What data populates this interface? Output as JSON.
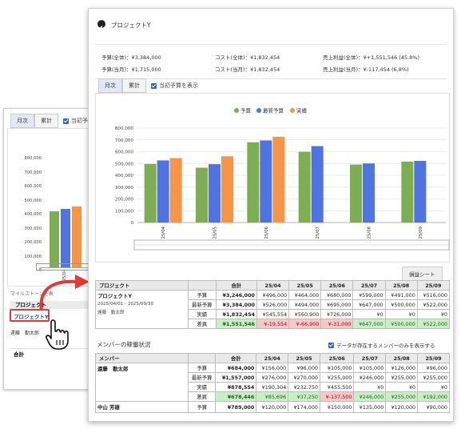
{
  "bg": {
    "tabs": [
      "月次",
      "累計"
    ],
    "checkbox_label": "当初予算を",
    "y_ticks": [
      "800,000",
      "700,000",
      "600,000",
      "500,000",
      "400,000",
      "300,000",
      "200,000",
      "100,000",
      "0"
    ],
    "x_label": "25/04",
    "milestone_label": "マイルストーンを表",
    "project_header": "プロジェクト",
    "project_name": "プロジェクトY",
    "member_name": "遠藤　勤太郎",
    "total_label": "合計"
  },
  "fg": {
    "title": "プロジェクトY",
    "summary": {
      "budget_total": "予算(全体)：¥3,384,000",
      "budget_month": "予算(当月)：¥1,715,000",
      "cost_total": "コスト(全体)：¥1,832,454",
      "cost_month": "コスト(当月)：¥1,832,454",
      "profit_total": "売上利益(全体)：¥+1,551,546 (45.8%)",
      "profit_month": "売上利益(当月)：¥-117,454 (6.8%)"
    },
    "tabs": [
      "月次",
      "累計"
    ],
    "checkbox_label": "当初予算を表示",
    "pl_button": "損益シート",
    "project_table": {
      "headers": [
        "プロジェクト",
        "",
        "合計",
        "25/04",
        "25/05",
        "25/06",
        "25/07",
        "25/08",
        "25/09"
      ],
      "name": "プロジェクトY",
      "period": "2025/04/01 - 2025/09/30",
      "member": "遠藤　勤太郎",
      "rows": [
        {
          "label": "予算",
          "values": [
            "¥3,246,000",
            "¥496,000",
            "¥464,000",
            "¥680,000",
            "¥599,000",
            "¥491,000",
            "¥516,000"
          ]
        },
        {
          "label": "最新予算",
          "values": [
            "¥3,384,000",
            "¥526,000",
            "¥494,000",
            "¥695,000",
            "¥647,000",
            "¥500,000",
            "¥522,000"
          ]
        },
        {
          "label": "実績",
          "values": [
            "¥1,832,454",
            "¥545,554",
            "¥560,900",
            "¥726,000",
            "¥0",
            "¥0",
            "¥0"
          ]
        },
        {
          "label": "差異",
          "values": [
            "¥1,551,546",
            "¥-19,554",
            "¥-66,900",
            "¥-31,000",
            "¥647,000",
            "¥500,000",
            "¥522,000"
          ]
        }
      ]
    },
    "member_section_title": "メンバーの稼働状況",
    "member_checkbox_label": "データが存在するメンバーのみを表示する",
    "member_table": {
      "headers": [
        "メンバー",
        "",
        "合計",
        "25/04",
        "25/05",
        "25/06",
        "25/07",
        "25/08",
        "25/09"
      ],
      "member1": "遠藤　勤太郎",
      "member1_rows": [
        {
          "label": "予算",
          "values": [
            "¥684,000",
            "¥156,000",
            "¥96,000",
            "¥105,000",
            "¥105,000",
            "¥126,000",
            "¥96,000"
          ]
        },
        {
          "label": "最新予算",
          "values": [
            "¥1,557,000",
            "¥276,000",
            "¥270,000",
            "¥255,000",
            "¥246,000",
            "¥255,000",
            "¥255,000"
          ]
        },
        {
          "label": "実績",
          "values": [
            "¥878,554",
            "¥190,304",
            "¥232,750",
            "¥455,500",
            "¥0",
            "¥0",
            "¥0"
          ]
        },
        {
          "label": "差異",
          "values": [
            "¥678,446",
            "¥85,696",
            "¥37,250",
            "¥-137,500",
            "¥246,000",
            "¥255,000",
            "¥192,000"
          ]
        }
      ],
      "member2": "中山 芳雄",
      "member2_rows": [
        {
          "label": "予算",
          "values": [
            "¥789,000",
            "¥120,000",
            "¥174,000",
            "¥150,000",
            "¥135,000",
            "¥120,000",
            "¥90,000"
          ]
        }
      ]
    }
  },
  "chart_data": {
    "type": "bar",
    "categories": [
      "25/04",
      "25/05",
      "25/06",
      "25/07",
      "25/08",
      "25/09"
    ],
    "series": [
      {
        "name": "予算",
        "color": "#7dae52",
        "values": [
          496000,
          464000,
          680000,
          599000,
          491000,
          516000
        ]
      },
      {
        "name": "最新予算",
        "color": "#4f73e3",
        "values": [
          526000,
          494000,
          695000,
          647000,
          500000,
          522000
        ]
      },
      {
        "name": "実績",
        "color": "#f79448",
        "values": [
          545554,
          560900,
          726000,
          0,
          0,
          0
        ]
      }
    ],
    "y_ticks": [
      "0",
      "100,000",
      "200,000",
      "300,000",
      "400,000",
      "500,000",
      "600,000",
      "700,000",
      "800,000"
    ],
    "ylim": [
      0,
      800000
    ],
    "legend": "top"
  },
  "colors": {
    "accent": "#4f73e3",
    "callout": "#e53935"
  }
}
